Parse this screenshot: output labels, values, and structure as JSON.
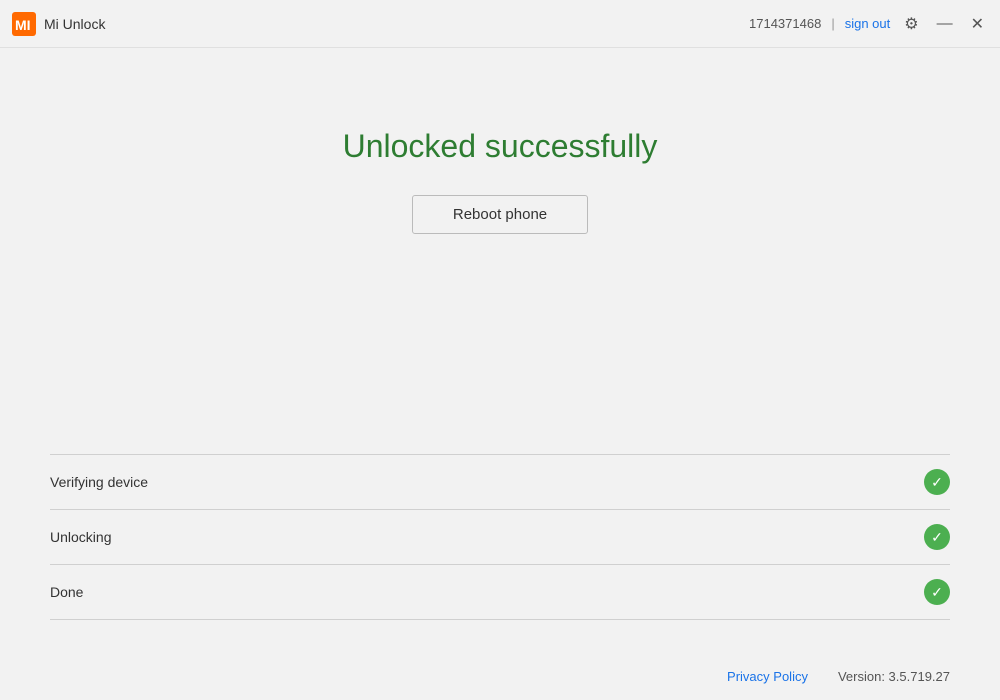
{
  "titlebar": {
    "logo_label": "MI",
    "app_title": "Mi Unlock",
    "user_id": "1714371468",
    "separator": "|",
    "sign_out_label": "sign out",
    "settings_icon": "⚙",
    "minimize_icon": "—",
    "close_icon": "✕"
  },
  "main": {
    "success_title": "Unlocked successfully",
    "reboot_button_label": "Reboot phone"
  },
  "steps": [
    {
      "label": "Verifying device",
      "status": "done"
    },
    {
      "label": "Unlocking",
      "status": "done"
    },
    {
      "label": "Done",
      "status": "done"
    }
  ],
  "footer": {
    "privacy_label": "Privacy Policy",
    "version_label": "Version: 3.5.719.27"
  }
}
